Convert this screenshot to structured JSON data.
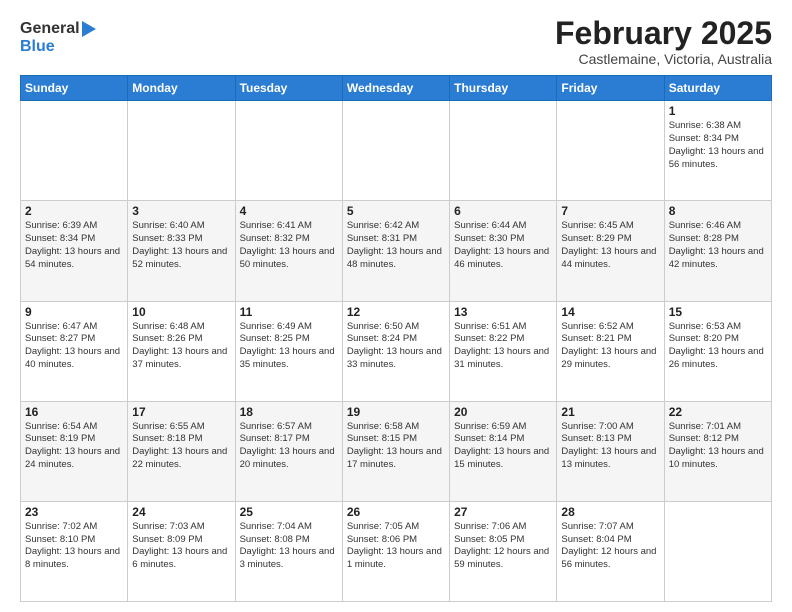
{
  "header": {
    "logo_line1": "General",
    "logo_line2": "Blue",
    "month_title": "February 2025",
    "location": "Castlemaine, Victoria, Australia"
  },
  "days_of_week": [
    "Sunday",
    "Monday",
    "Tuesday",
    "Wednesday",
    "Thursday",
    "Friday",
    "Saturday"
  ],
  "weeks": [
    [
      {
        "day": "",
        "info": ""
      },
      {
        "day": "",
        "info": ""
      },
      {
        "day": "",
        "info": ""
      },
      {
        "day": "",
        "info": ""
      },
      {
        "day": "",
        "info": ""
      },
      {
        "day": "",
        "info": ""
      },
      {
        "day": "1",
        "info": "Sunrise: 6:38 AM\nSunset: 8:34 PM\nDaylight: 13 hours and 56 minutes."
      }
    ],
    [
      {
        "day": "2",
        "info": "Sunrise: 6:39 AM\nSunset: 8:34 PM\nDaylight: 13 hours and 54 minutes."
      },
      {
        "day": "3",
        "info": "Sunrise: 6:40 AM\nSunset: 8:33 PM\nDaylight: 13 hours and 52 minutes."
      },
      {
        "day": "4",
        "info": "Sunrise: 6:41 AM\nSunset: 8:32 PM\nDaylight: 13 hours and 50 minutes."
      },
      {
        "day": "5",
        "info": "Sunrise: 6:42 AM\nSunset: 8:31 PM\nDaylight: 13 hours and 48 minutes."
      },
      {
        "day": "6",
        "info": "Sunrise: 6:44 AM\nSunset: 8:30 PM\nDaylight: 13 hours and 46 minutes."
      },
      {
        "day": "7",
        "info": "Sunrise: 6:45 AM\nSunset: 8:29 PM\nDaylight: 13 hours and 44 minutes."
      },
      {
        "day": "8",
        "info": "Sunrise: 6:46 AM\nSunset: 8:28 PM\nDaylight: 13 hours and 42 minutes."
      }
    ],
    [
      {
        "day": "9",
        "info": "Sunrise: 6:47 AM\nSunset: 8:27 PM\nDaylight: 13 hours and 40 minutes."
      },
      {
        "day": "10",
        "info": "Sunrise: 6:48 AM\nSunset: 8:26 PM\nDaylight: 13 hours and 37 minutes."
      },
      {
        "day": "11",
        "info": "Sunrise: 6:49 AM\nSunset: 8:25 PM\nDaylight: 13 hours and 35 minutes."
      },
      {
        "day": "12",
        "info": "Sunrise: 6:50 AM\nSunset: 8:24 PM\nDaylight: 13 hours and 33 minutes."
      },
      {
        "day": "13",
        "info": "Sunrise: 6:51 AM\nSunset: 8:22 PM\nDaylight: 13 hours and 31 minutes."
      },
      {
        "day": "14",
        "info": "Sunrise: 6:52 AM\nSunset: 8:21 PM\nDaylight: 13 hours and 29 minutes."
      },
      {
        "day": "15",
        "info": "Sunrise: 6:53 AM\nSunset: 8:20 PM\nDaylight: 13 hours and 26 minutes."
      }
    ],
    [
      {
        "day": "16",
        "info": "Sunrise: 6:54 AM\nSunset: 8:19 PM\nDaylight: 13 hours and 24 minutes."
      },
      {
        "day": "17",
        "info": "Sunrise: 6:55 AM\nSunset: 8:18 PM\nDaylight: 13 hours and 22 minutes."
      },
      {
        "day": "18",
        "info": "Sunrise: 6:57 AM\nSunset: 8:17 PM\nDaylight: 13 hours and 20 minutes."
      },
      {
        "day": "19",
        "info": "Sunrise: 6:58 AM\nSunset: 8:15 PM\nDaylight: 13 hours and 17 minutes."
      },
      {
        "day": "20",
        "info": "Sunrise: 6:59 AM\nSunset: 8:14 PM\nDaylight: 13 hours and 15 minutes."
      },
      {
        "day": "21",
        "info": "Sunrise: 7:00 AM\nSunset: 8:13 PM\nDaylight: 13 hours and 13 minutes."
      },
      {
        "day": "22",
        "info": "Sunrise: 7:01 AM\nSunset: 8:12 PM\nDaylight: 13 hours and 10 minutes."
      }
    ],
    [
      {
        "day": "23",
        "info": "Sunrise: 7:02 AM\nSunset: 8:10 PM\nDaylight: 13 hours and 8 minutes."
      },
      {
        "day": "24",
        "info": "Sunrise: 7:03 AM\nSunset: 8:09 PM\nDaylight: 13 hours and 6 minutes."
      },
      {
        "day": "25",
        "info": "Sunrise: 7:04 AM\nSunset: 8:08 PM\nDaylight: 13 hours and 3 minutes."
      },
      {
        "day": "26",
        "info": "Sunrise: 7:05 AM\nSunset: 8:06 PM\nDaylight: 13 hours and 1 minute."
      },
      {
        "day": "27",
        "info": "Sunrise: 7:06 AM\nSunset: 8:05 PM\nDaylight: 12 hours and 59 minutes."
      },
      {
        "day": "28",
        "info": "Sunrise: 7:07 AM\nSunset: 8:04 PM\nDaylight: 12 hours and 56 minutes."
      },
      {
        "day": "",
        "info": ""
      }
    ]
  ]
}
